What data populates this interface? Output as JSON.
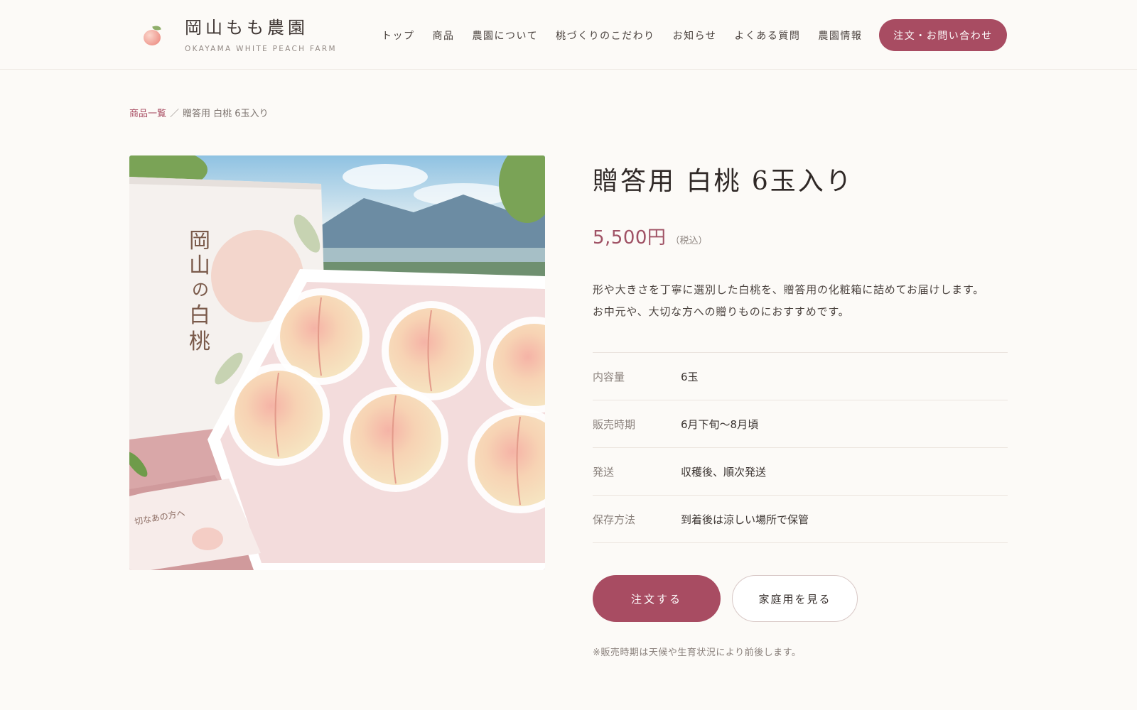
{
  "brand": {
    "name": "岡山もも農園",
    "subtitle": "OKAYAMA WHITE PEACH FARM"
  },
  "nav": {
    "items": [
      "トップ",
      "商品",
      "農園について",
      "桃づくりのこだわり",
      "お知らせ",
      "よくある質問",
      "農園情報"
    ],
    "contact_label": "注文・お問い合わせ"
  },
  "breadcrumb": {
    "parent": "商品一覧",
    "separator": "／",
    "current": "贈答用 白桃 6玉入り"
  },
  "product": {
    "title": "贈答用 白桃 6玉入り",
    "price": "5,500円",
    "tax_note": "（税込）",
    "description": [
      "形や大きさを丁寧に選別した白桃を、贈答用の化粧箱に詰めてお届けします。",
      "お中元や、大切な方への贈りものにおすすめです。"
    ],
    "specs": [
      {
        "label": "内容量",
        "value": "6玉"
      },
      {
        "label": "販売時期",
        "value": "6月下旬〜8月頃"
      },
      {
        "label": "発送",
        "value": "収穫後、順次発送"
      },
      {
        "label": "保存方法",
        "value": "到着後は涼しい場所で保管"
      }
    ],
    "order_label": "注文する",
    "home_label": "家庭用を見る",
    "note": "※販売時期は天候や生育状況により前後します。",
    "image_box_text": "岡山の白桃",
    "image_card_text": "切なあの方へ"
  },
  "colors": {
    "accent": "#a84c62",
    "background": "#fcfaf7",
    "text": "#3a3330"
  }
}
